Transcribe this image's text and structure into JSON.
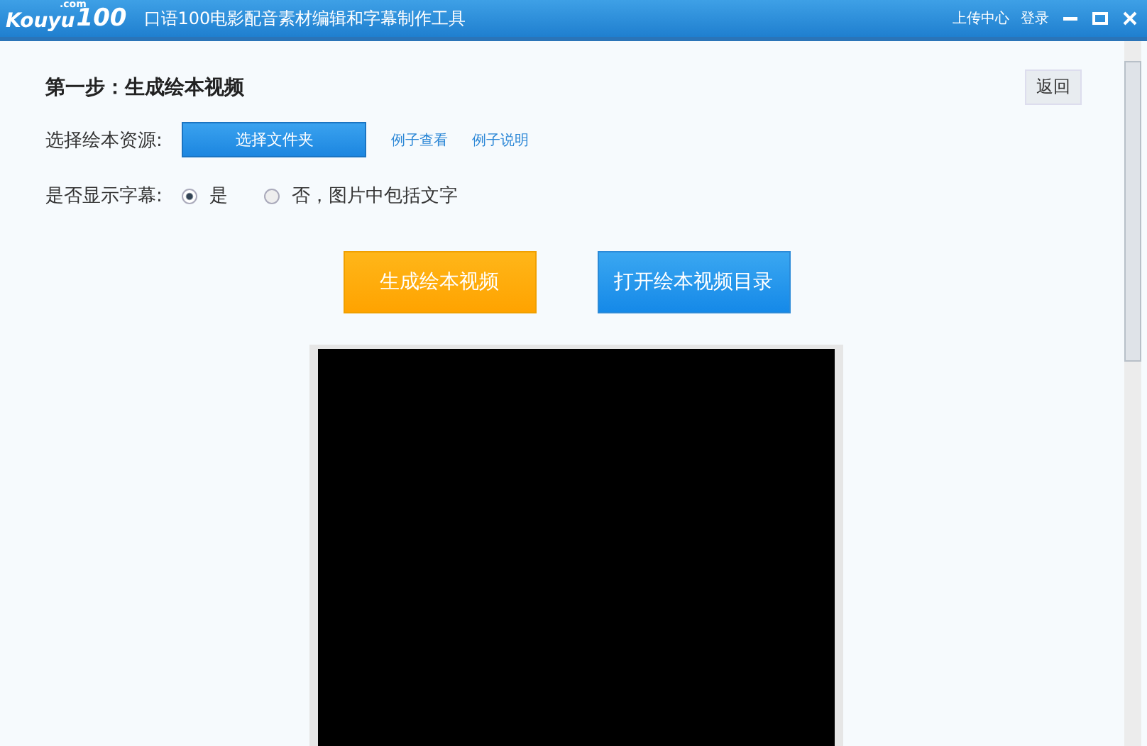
{
  "logo": {
    "sup": ".com",
    "name": "Kouyu",
    "number": "100"
  },
  "window": {
    "title": "口语100电影配音素材编辑和字幕制作工具",
    "links": [
      "上传中心",
      "登录"
    ]
  },
  "step": {
    "title": "第一步：生成绘本视频",
    "back": "返回"
  },
  "source": {
    "label": "选择绘本资源:",
    "button": "选择文件夹",
    "links": [
      "例子查看",
      "例子说明"
    ]
  },
  "subtitles": {
    "label": "是否显示字幕:",
    "options": [
      {
        "label": "是",
        "selected": true
      },
      {
        "label": "否，图片中包括文字",
        "selected": false
      }
    ]
  },
  "actions": [
    {
      "label": "生成绘本视频",
      "kind": "orange"
    },
    {
      "label": "打开绘本视频目录",
      "kind": "blue"
    }
  ]
}
